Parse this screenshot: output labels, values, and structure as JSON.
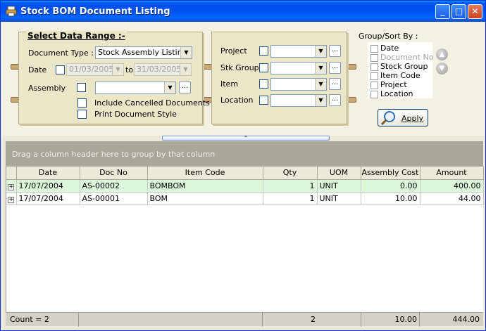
{
  "window": {
    "title": "Stock BOM Document Listing",
    "accent": "#0053ee"
  },
  "data_range": {
    "legend": "Select Data Range :-",
    "document_type_label": "Document Type :",
    "document_type_value": "Stock Assembly Listing",
    "date_label": "Date",
    "date_from": "01/03/2005",
    "date_to_label": "to",
    "date_to": "31/03/2005",
    "assembly_label": "Assembly",
    "include_cancelled_label": "Include Cancelled Documents",
    "print_style_label": "Print Document Style"
  },
  "filters": {
    "project_label": "Project",
    "stk_group_label": "Stk Group",
    "item_label": "Item",
    "location_label": "Location"
  },
  "group_sort": {
    "title": "Group/Sort By :",
    "items": [
      {
        "label": "Date",
        "enabled": true
      },
      {
        "label": "Document No",
        "enabled": false
      },
      {
        "label": "Stock Group",
        "enabled": true
      },
      {
        "label": "Item Code",
        "enabled": true
      },
      {
        "label": "Project",
        "enabled": true
      },
      {
        "label": "Location",
        "enabled": true
      }
    ]
  },
  "apply_button": {
    "label": "Apply"
  },
  "group_area": {
    "hint": "Drag a column header here to group by that column"
  },
  "grid": {
    "columns": [
      "Date",
      "Doc No",
      "Item Code",
      "Qty",
      "UOM",
      "Assembly Cost",
      "Amount"
    ],
    "rows": [
      {
        "date": "17/07/2004",
        "doc_no": "AS-00002",
        "item_code": "BOMBOM",
        "qty": "1",
        "uom": "UNIT",
        "assembly_cost": "0.00",
        "amount": "400.00"
      },
      {
        "date": "17/07/2004",
        "doc_no": "AS-00001",
        "item_code": "BOM",
        "qty": "1",
        "uom": "UNIT",
        "assembly_cost": "10.00",
        "amount": "44.00"
      }
    ]
  },
  "footer": {
    "count": "Count = 2",
    "qty_total": "2",
    "assembly_cost_total": "10.00",
    "amount_total": "444.00"
  }
}
